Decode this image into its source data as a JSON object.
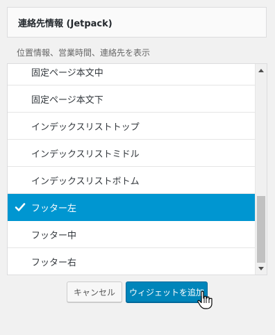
{
  "widget": {
    "title": "連絡先情報",
    "title_suffix": "(Jetpack)",
    "description": "位置情報、営業時間、連絡先を表示"
  },
  "sidebar_list": {
    "items": [
      {
        "label": "固定ページ本文中",
        "selected": false
      },
      {
        "label": "固定ページ本文下",
        "selected": false
      },
      {
        "label": "インデックスリストトップ",
        "selected": false
      },
      {
        "label": "インデックスリストミドル",
        "selected": false
      },
      {
        "label": "インデックスリストボトム",
        "selected": false
      },
      {
        "label": "フッター左",
        "selected": true
      },
      {
        "label": "フッター中",
        "selected": false
      },
      {
        "label": "フッター右",
        "selected": false
      }
    ]
  },
  "buttons": {
    "cancel": "キャンセル",
    "add_widget": "ウィジェットを追加"
  },
  "icons": {
    "check": "check-icon",
    "scroll_up": "arrow-up-icon",
    "scroll_down": "arrow-down-icon",
    "cursor": "hand-pointer-icon"
  },
  "colors": {
    "selected_bg": "#0096d1",
    "primary_button": "#0085ba"
  }
}
